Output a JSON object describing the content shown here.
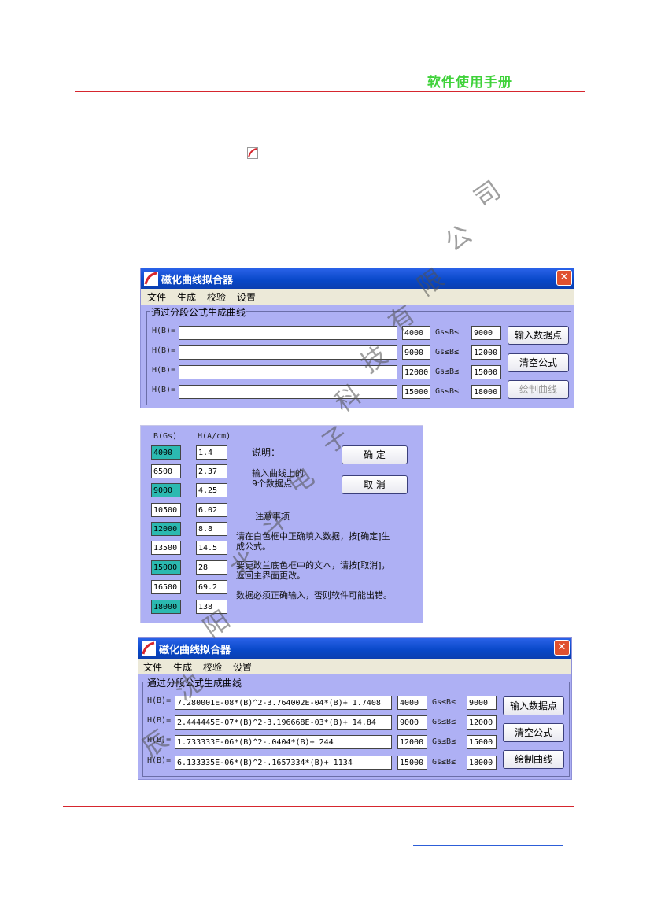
{
  "header": {
    "title": "软件使用手册"
  },
  "window1": {
    "title": "磁化曲线拟合器",
    "menu": [
      "文件",
      "生成",
      "校验",
      "设置"
    ],
    "group_label": "通过分段公式生成曲线",
    "row_label": "H(B)=",
    "range_label": "Gs≤B≤",
    "rows": [
      {
        "formula": "",
        "from": "4000",
        "to": "9000"
      },
      {
        "formula": "",
        "from": "9000",
        "to": "12000"
      },
      {
        "formula": "",
        "from": "12000",
        "to": "15000"
      },
      {
        "formula": "",
        "from": "15000",
        "to": "18000"
      }
    ],
    "buttons": {
      "input": "输入数据点",
      "clear": "清空公式",
      "plot": "绘制曲线"
    }
  },
  "dialog": {
    "col_b": "B(Gs)",
    "col_h": "H(A/cm)",
    "points": [
      {
        "b": "4000",
        "h": "1.4"
      },
      {
        "b": "6500",
        "h": "2.37"
      },
      {
        "b": "9000",
        "h": "4.25"
      },
      {
        "b": "10500",
        "h": "6.02"
      },
      {
        "b": "12000",
        "h": "8.8"
      },
      {
        "b": "13500",
        "h": "14.5"
      },
      {
        "b": "15000",
        "h": "28"
      },
      {
        "b": "16500",
        "h": "69.2"
      },
      {
        "b": "18000",
        "h": "138"
      }
    ],
    "desc_title": "说明：",
    "desc_line1": "输入曲线上的",
    "desc_line2": "9个数据点",
    "ok": "确  定",
    "cancel": "取  消",
    "notes_title": "注意事项",
    "note1a": "请在白色框中正确填入数据，按[确定]生",
    "note1b": "成公式。",
    "note2a": "要更改兰底色框中的文本，请按[取消]，",
    "note2b": "返回主界面更改。",
    "note3": "数据必须正确输入，否则软件可能出错。"
  },
  "window2": {
    "title": "磁化曲线拟合器",
    "menu": [
      "文件",
      "生成",
      "校验",
      "设置"
    ],
    "group_label": "通过分段公式生成曲线",
    "row_label": "H(B)=",
    "range_label": "Gs≤B≤",
    "rows": [
      {
        "formula": "7.280001E-08*(B)^2-3.764002E-04*(B)+ 1.7408",
        "from": "4000",
        "to": "9000"
      },
      {
        "formula": "2.444445E-07*(B)^2-3.196668E-03*(B)+ 14.84",
        "from": "9000",
        "to": "12000"
      },
      {
        "formula": "1.733333E-06*(B)^2-.0404*(B)+ 244",
        "from": "12000",
        "to": "15000"
      },
      {
        "formula": "6.133335E-06*(B)^2-.1657334*(B)+ 1134",
        "from": "15000",
        "to": "18000"
      }
    ],
    "buttons": {
      "input": "输入数据点",
      "clear": "清空公式",
      "plot": "绘制曲线"
    }
  },
  "watermark": [
    "司",
    "公",
    "限",
    "有",
    "技",
    "科",
    "子",
    "电",
    "斗",
    "北",
    "阳",
    "沈",
    "辰"
  ]
}
